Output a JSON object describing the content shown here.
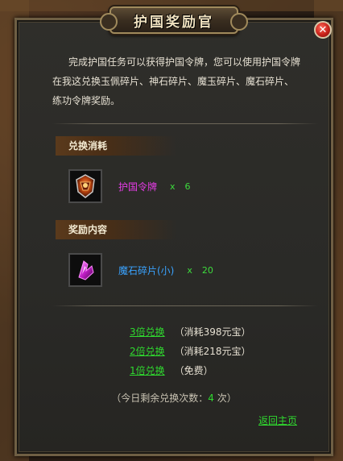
{
  "window": {
    "title": "护国奖励官",
    "close_label": "✕"
  },
  "intro": {
    "line1": "完成护国任务可以获得护国令牌，您可以使用护国令牌",
    "line2": "在我这兑换玉佩碎片、神石碎片、魔玉碎片、魔石碎片、",
    "line3": "练功令牌奖励。"
  },
  "cost_section": {
    "heading": "兑换消耗",
    "item": {
      "icon": "guard-token-icon",
      "name": "护国令牌",
      "name_color": "#e43ce4",
      "x": "x",
      "quantity": "6"
    }
  },
  "reward_section": {
    "heading": "奖励内容",
    "item": {
      "icon": "magic-stone-fragment-icon",
      "name": "魔石碎片(小)",
      "name_color": "#3aa3ff",
      "x": "x",
      "quantity": "20"
    }
  },
  "exchange_options": [
    {
      "label": "3倍兑换",
      "cost": "（消耗398元宝）"
    },
    {
      "label": "2倍兑换",
      "cost": "（消耗218元宝）"
    },
    {
      "label": "1倍兑换",
      "cost": "（免费）"
    }
  ],
  "remaining": {
    "prefix": "（今日剩余兑换次数：",
    "count": "4",
    "suffix": " 次）"
  },
  "back_label": "返回主页",
  "colors": {
    "link_green": "#2fd92f",
    "text": "#e6e0d2",
    "accent_red": "#c8221a"
  }
}
